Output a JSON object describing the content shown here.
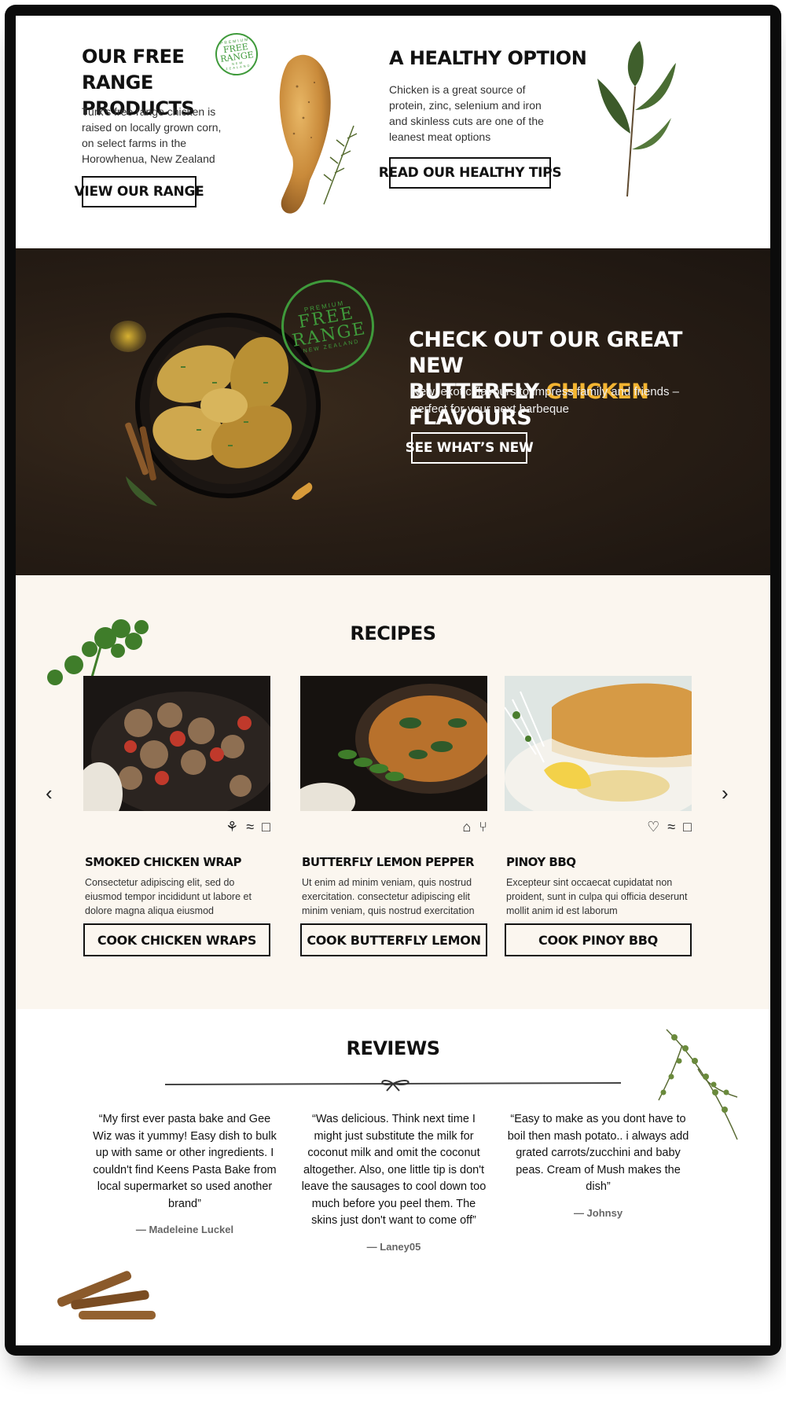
{
  "free_range": {
    "title": "OUR FREE RANGE PRODUCTS",
    "body": "Turk's free range chicken is raised on locally grown corn, on select farms in the Horowhenua, New Zealand",
    "button": "VIEW OUR RANGE",
    "stamp": {
      "top": "PREMIUM",
      "big_1": "FREE",
      "big_2": "RANGE",
      "bottom": "NEW ZEALAND"
    }
  },
  "healthy": {
    "title": "A HEALTHY OPTION",
    "body": "Chicken is a great source of protein, zinc, selenium and iron and skinless cuts are one of the leanest meat options",
    "button": "READ OUR HEALTHY TIPS"
  },
  "hero": {
    "title_line1": "CHECK OUT OUR GREAT NEW",
    "title_pre": "BUTTERFLY",
    "title_highlight": "CHICKEN",
    "title_post": "FLAVOURS",
    "subtitle": "New, exotic flavours to impress family and friends – perfect for your next barbeque",
    "button": "SEE WHAT’S NEW",
    "stamp": {
      "top": "PREMIUM",
      "big_1": "FREE",
      "big_2": "RANGE",
      "bottom": "NEW ZEALAND"
    },
    "highlight_color": "#f3b431"
  },
  "recipes": {
    "title": "RECIPES",
    "prev_icon": "‹",
    "next_icon": "›",
    "cards": [
      {
        "title": "SMOKED CHICKEN WRAP",
        "desc": "Consectetur adipiscing elit, sed do eiusmod tempor incididunt ut labore et dolore magna aliqua eiusmod",
        "button": "COOK CHICKEN WRAPS",
        "icons": [
          "⚘",
          "≈",
          "□"
        ]
      },
      {
        "title": "BUTTERFLY LEMON PEPPER",
        "desc": "Ut enim ad minim veniam, quis nostrud exercitation. consectetur adipiscing elit minim veniam, quis nostrud exercitation",
        "button": "COOK BUTTERFLY LEMON",
        "icons": [
          "⌂",
          "⑂"
        ]
      },
      {
        "title": "PINOY BBQ",
        "desc": "Excepteur sint occaecat cupidatat non proident, sunt in culpa qui officia deserunt mollit anim id est laborum",
        "button": "COOK PINOY BBQ",
        "icons": [
          "♡",
          "≈",
          "□"
        ]
      }
    ]
  },
  "reviews": {
    "title": "REVIEWS",
    "items": [
      {
        "quote": "“My first ever pasta bake and Gee Wiz was it yummy! Easy dish to bulk up with same or other ingredients. I couldn't find Keens Pasta Bake from local supermarket so used another brand”",
        "author": "— Madeleine Luckel"
      },
      {
        "quote": "“Was delicious. Think next time I might just substitute the milk for coconut milk and omit the coconut altogether. Also, one little tip is don't leave the sausages to cool down too much before you peel them. The skins just don't want to come off”",
        "author": "— Laney05"
      },
      {
        "quote": "“Easy to make as you dont have to boil then mash potato.. i always add grated carrots/zucchini and baby peas. Cream of Mush makes the dish”",
        "author": "— Johnsy"
      }
    ]
  }
}
